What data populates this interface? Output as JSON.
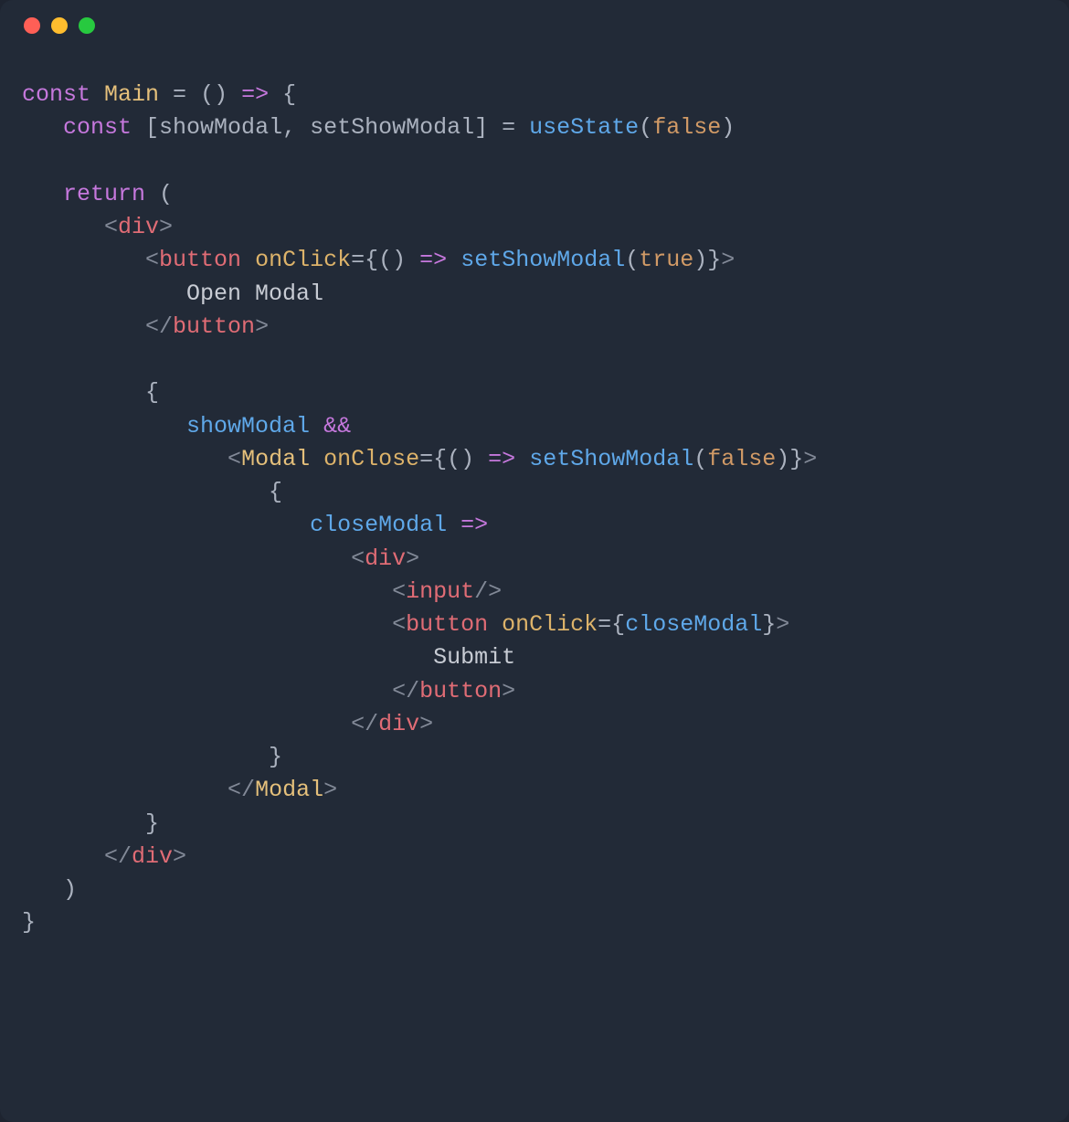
{
  "code": {
    "tokens": {
      "const1": "const",
      "main": "Main",
      "eq1": " = ",
      "arrow_open": "() ",
      "arrow": "=>",
      "lbrace1": " {",
      "const2": "const",
      "destruct_open": " [",
      "showModal": "showModal",
      "comma1": ", ",
      "setShowModal": "setShowModal",
      "destruct_close": "] = ",
      "useState": "useState",
      "lparen1": "(",
      "false1": "false",
      "rparen1": ")",
      "return": "return",
      "lparen2": " (",
      "lt1": "<",
      "div1": "div",
      "gt1": ">",
      "lt2": "<",
      "button1": "button",
      "onClick1": "onClick",
      "eqbrace1": "=",
      "lbrace2": "{",
      "arrowfn1": "() ",
      "arrow2": "=>",
      "sp1": " ",
      "setShowModal2": "setShowModal",
      "lparen3": "(",
      "true1": "true",
      "rparen3": ")",
      "rbrace2": "}",
      "gt2": ">",
      "openModalText": "Open Modal",
      "ltc1": "</",
      "button1c": "button",
      "gtc1": ">",
      "lbrace3": "{",
      "showModal2": "showModal",
      "ampamp": "&&",
      "lt3": "<",
      "Modal": "Modal",
      "onClose": "onClose",
      "eqbrace2": "=",
      "lbrace4": "{",
      "arrowfn2": "() ",
      "arrow3": "=>",
      "sp2": " ",
      "setShowModal3": "setShowModal",
      "lparen4": "(",
      "false2": "false",
      "rparen4": ")",
      "rbrace4": "}",
      "gt3": ">",
      "lbrace5": "{",
      "closeModal": "closeModal",
      "arrow4": " =>",
      "lt4": "<",
      "div2": "div",
      "gt4": ">",
      "lt5": "<",
      "input": "input",
      "selfclose": "/>",
      "lt6": "<",
      "button2": "button",
      "onClick2": "onClick",
      "eqbrace3": "=",
      "lbrace6": "{",
      "closeModal2": "closeModal",
      "rbrace6": "}",
      "gt6": ">",
      "submitText": "Submit",
      "ltc2": "</",
      "button2c": "button",
      "gtc2": ">",
      "ltc3": "</",
      "div2c": "div",
      "gtc3": ">",
      "rbrace5": "}",
      "ltc4": "</",
      "Modalc": "Modal",
      "gtc4": ">",
      "rbrace3": "}",
      "ltc5": "</",
      "div1c": "div",
      "gtc5": ">",
      "rparen2": ")",
      "rbrace1": "}"
    }
  }
}
